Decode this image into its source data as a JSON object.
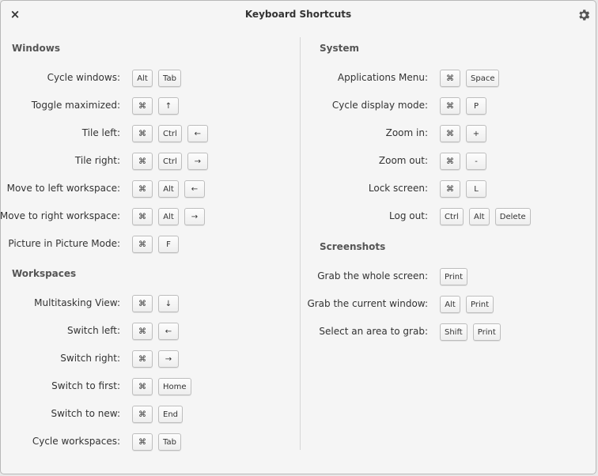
{
  "window": {
    "title": "Keyboard Shortcuts",
    "close_icon": "×"
  },
  "left": {
    "sections": [
      {
        "title": "Windows",
        "rows": [
          {
            "label": "Cycle windows:",
            "keys": [
              "Alt",
              "Tab"
            ]
          },
          {
            "label": "Toggle maximized:",
            "keys": [
              "⌘",
              "↑"
            ]
          },
          {
            "label": "Tile left:",
            "keys": [
              "⌘",
              "Ctrl",
              "←"
            ]
          },
          {
            "label": "Tile right:",
            "keys": [
              "⌘",
              "Ctrl",
              "→"
            ]
          },
          {
            "label": "Move to left workspace:",
            "keys": [
              "⌘",
              "Alt",
              "←"
            ]
          },
          {
            "label": "Move to right workspace:",
            "keys": [
              "⌘",
              "Alt",
              "→"
            ]
          },
          {
            "label": "Picture in Picture Mode:",
            "keys": [
              "⌘",
              "F"
            ]
          }
        ]
      },
      {
        "title": "Workspaces",
        "rows": [
          {
            "label": "Multitasking View:",
            "keys": [
              "⌘",
              "↓"
            ]
          },
          {
            "label": "Switch left:",
            "keys": [
              "⌘",
              "←"
            ]
          },
          {
            "label": "Switch right:",
            "keys": [
              "⌘",
              "→"
            ]
          },
          {
            "label": "Switch to first:",
            "keys": [
              "⌘",
              "Home"
            ]
          },
          {
            "label": "Switch to new:",
            "keys": [
              "⌘",
              "End"
            ]
          },
          {
            "label": "Cycle workspaces:",
            "keys": [
              "⌘",
              "Tab"
            ]
          }
        ]
      }
    ]
  },
  "right": {
    "sections": [
      {
        "title": "System",
        "rows": [
          {
            "label": "Applications Menu:",
            "keys": [
              "⌘",
              "Space"
            ]
          },
          {
            "label": "Cycle display mode:",
            "keys": [
              "⌘",
              "P"
            ]
          },
          {
            "label": "Zoom in:",
            "keys": [
              "⌘",
              "+"
            ]
          },
          {
            "label": "Zoom out:",
            "keys": [
              "⌘",
              "-"
            ]
          },
          {
            "label": "Lock screen:",
            "keys": [
              "⌘",
              "L"
            ]
          },
          {
            "label": "Log out:",
            "keys": [
              "Ctrl",
              "Alt",
              "Delete"
            ]
          }
        ]
      },
      {
        "title": "Screenshots",
        "rows": [
          {
            "label": "Grab the whole screen:",
            "keys": [
              "Print"
            ]
          },
          {
            "label": "Grab the current window:",
            "keys": [
              "Alt",
              "Print"
            ]
          },
          {
            "label": "Select an area to grab:",
            "keys": [
              "Shift",
              "Print"
            ]
          }
        ]
      }
    ]
  }
}
